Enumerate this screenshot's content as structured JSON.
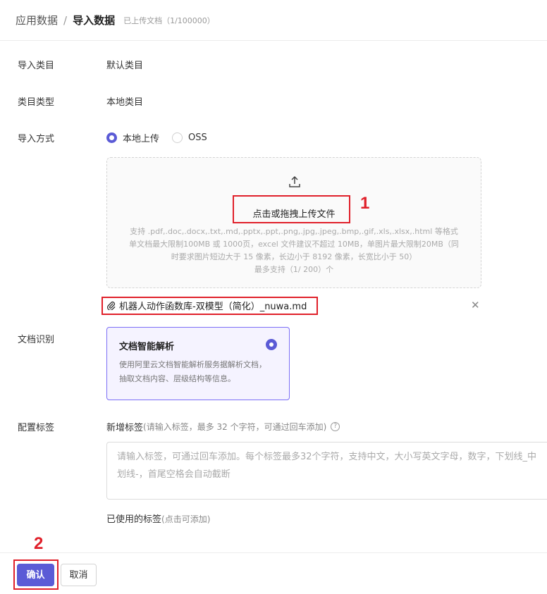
{
  "header": {
    "breadcrumb_parent": "应用数据",
    "separator": "/",
    "breadcrumb_current": "导入数据",
    "upload_count": "已上传文档（1/100000）"
  },
  "form": {
    "category_label": "导入类目",
    "category_value": "默认类目",
    "category_type_label": "类目类型",
    "category_type_value": "本地类目",
    "import_method_label": "导入方式",
    "import_options": [
      {
        "label": "本地上传",
        "checked": true
      },
      {
        "label": "OSS",
        "checked": false
      }
    ]
  },
  "upload": {
    "cta": "点击或拖拽上传文件",
    "hint_formats": "支持 .pdf,.doc,.docx,.txt,.md,.pptx,.ppt,.png,.jpg,.jpeg,.bmp,.gif,.xls,.xlsx,.html 等格式",
    "hint_limits_1": "单文档最大限制100MB 或 1000页，excel 文件建议不超过 10MB，单图片最大限制20MB（同",
    "hint_limits_2": "时要求图片短边大于 15 像素，长边小于 8192 像素，长宽比小于 50）",
    "hint_max": "最多支持（1/ 200）个",
    "file_name": "机器人动作函数库-双模型（简化）_nuwa.md"
  },
  "doc_recognition": {
    "label": "文档识别",
    "card_title": "文档智能解析",
    "card_desc": "使用阿里云文档智能解析服务据解析文档，抽取文档内容、层级结构等信息。"
  },
  "tags": {
    "label": "配置标签",
    "new_tag_title": "新增标签",
    "new_tag_hint": "(请输入标签，最多 32 个字符，可通过回车添加)",
    "input_placeholder": "请输入标签，可通过回车添加。每个标签最多32个字符，支持中文，大小写英文字母，数字，下划线_中划线-，首尾空格会自动截断",
    "used_title": "已使用的标签",
    "used_hint": "(点击可添加)"
  },
  "annotations": {
    "num1": "1",
    "num2": "2"
  },
  "footer": {
    "confirm": "确认",
    "cancel": "取消"
  },
  "colors": {
    "accent": "#5b5bd6",
    "annotation_red": "#e0202a"
  },
  "icons": [
    "upload-icon",
    "paperclip-icon",
    "close-icon",
    "radio-checked-icon",
    "help-icon"
  ]
}
